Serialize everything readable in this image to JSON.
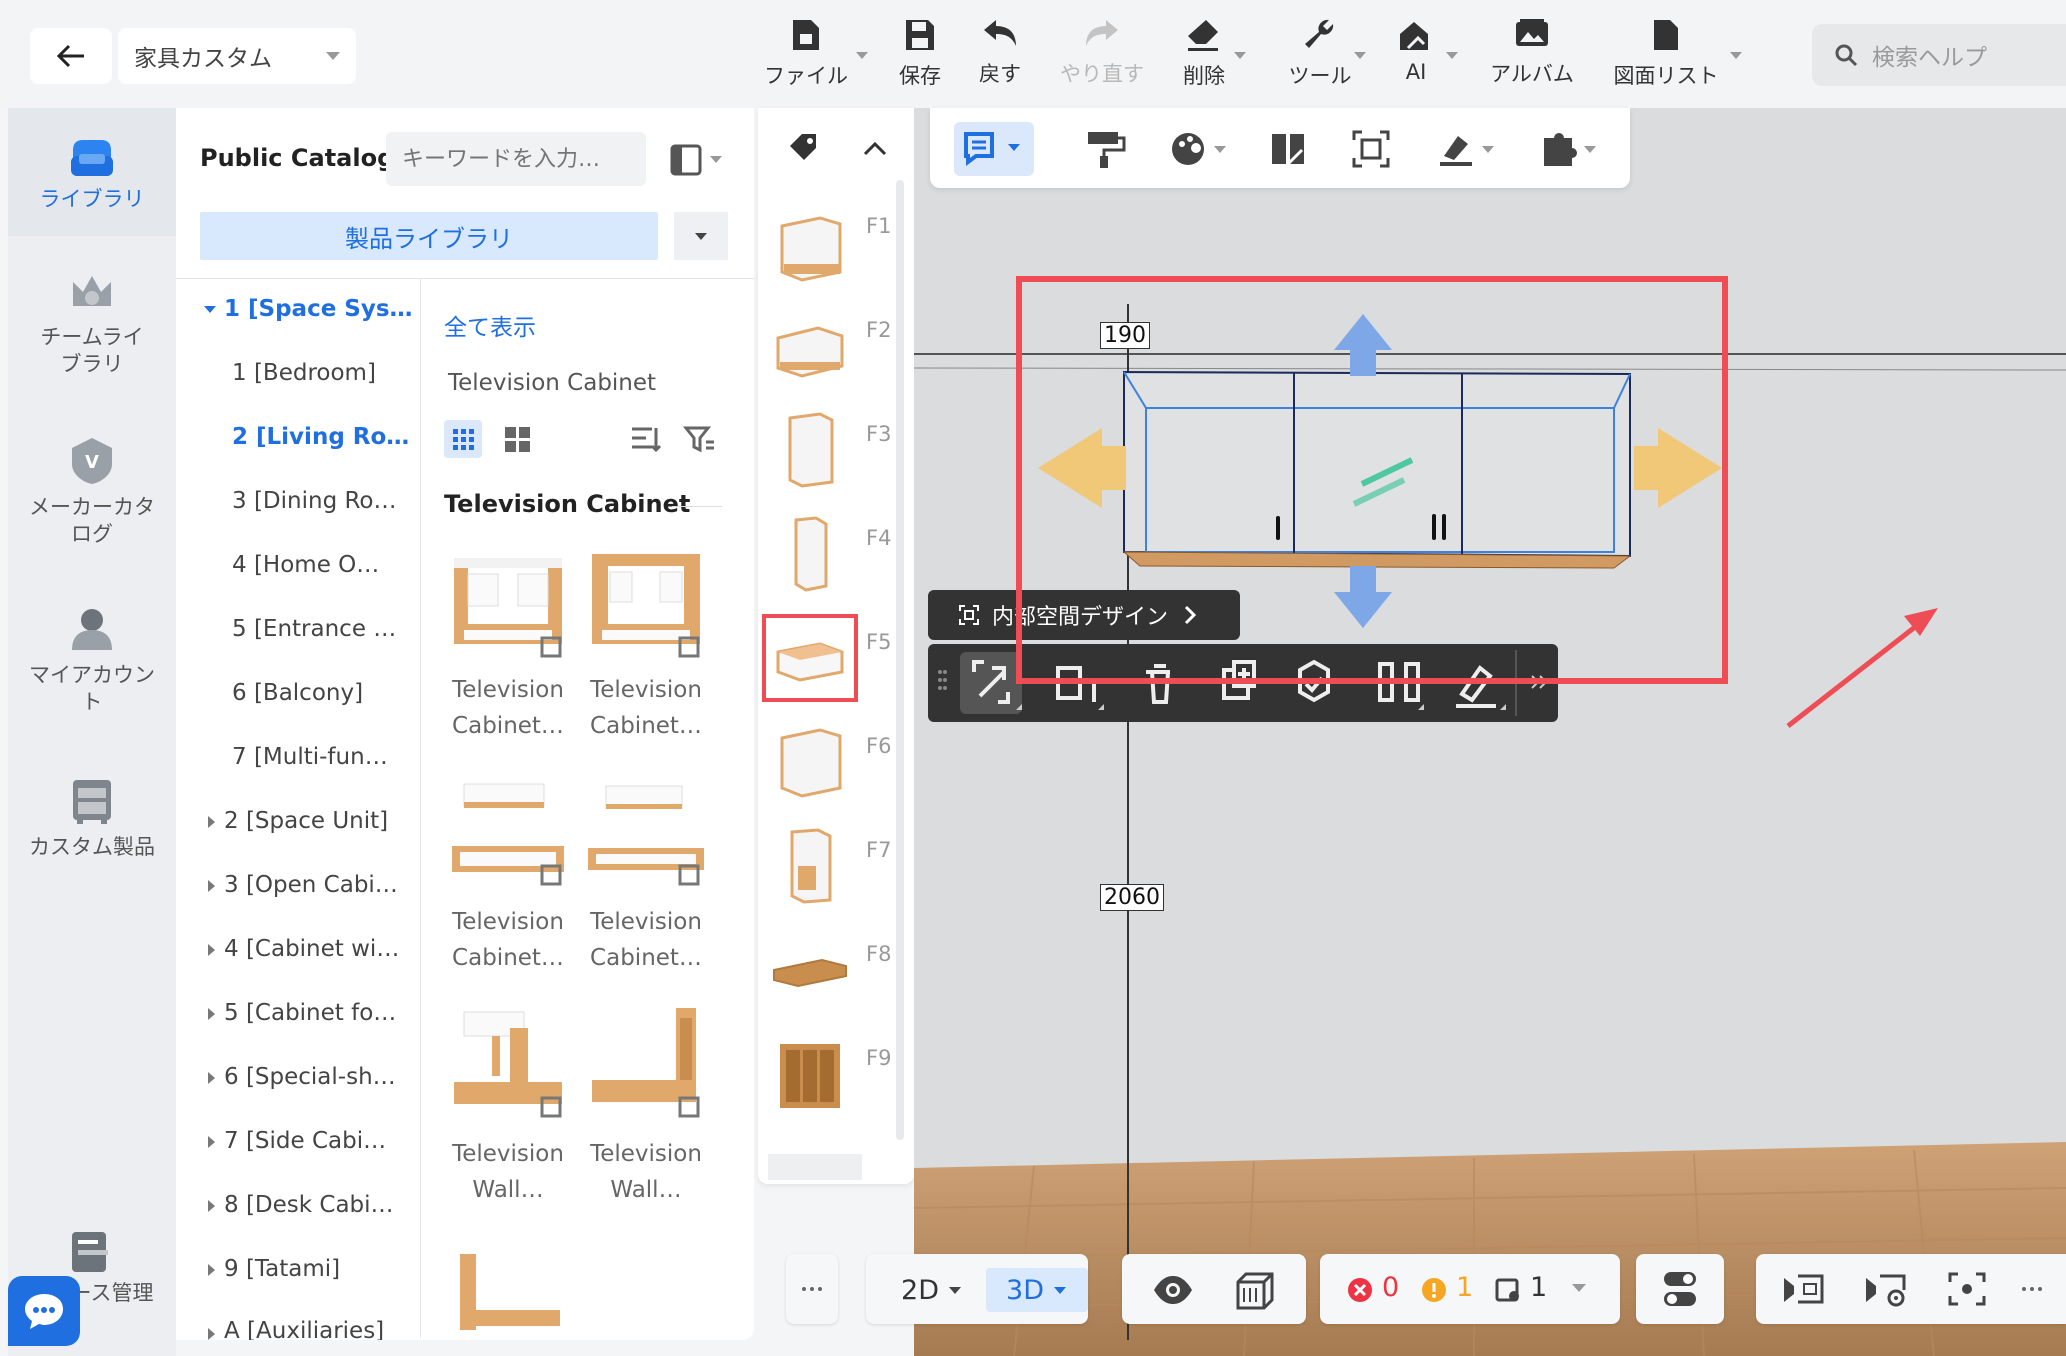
{
  "header": {
    "category_value": "家具カスタム",
    "toolbar": [
      {
        "id": "file",
        "label": "ファイル",
        "icon": "file-icon",
        "has_menu": true
      },
      {
        "id": "save",
        "label": "保存",
        "icon": "save-icon",
        "has_menu": false
      },
      {
        "id": "undo",
        "label": "戻す",
        "icon": "undo-icon",
        "has_menu": false
      },
      {
        "id": "redo",
        "label": "やり直す",
        "icon": "redo-icon",
        "has_menu": false,
        "disabled": true
      },
      {
        "id": "delete",
        "label": "削除",
        "icon": "eraser-icon",
        "has_menu": true
      },
      {
        "id": "tools",
        "label": "ツール",
        "icon": "wrench-icon",
        "has_menu": true
      },
      {
        "id": "ai",
        "label": "AI",
        "icon": "ai-house-icon",
        "has_menu": true
      },
      {
        "id": "album",
        "label": "アルバム",
        "icon": "album-icon",
        "has_menu": false
      },
      {
        "id": "drawings",
        "label": "図面リスト",
        "icon": "document-icon",
        "has_menu": true
      }
    ],
    "help_placeholder": "検索ヘルプ"
  },
  "sidebar": {
    "items": [
      {
        "label": "ライブラリ",
        "icon": "library-icon",
        "active": true
      },
      {
        "label": "チームライブラリ",
        "icon": "crown-icon",
        "active": false
      },
      {
        "label": "メーカーカタログ",
        "icon": "badge-icon",
        "active": false
      },
      {
        "label": "マイアカウント",
        "icon": "user-icon",
        "active": false
      },
      {
        "label": "カスタム製品",
        "icon": "cabinet-icon",
        "active": false
      },
      {
        "label": "ース管理",
        "icon": "manage-icon",
        "active": false
      }
    ]
  },
  "catalog": {
    "title": "Public Catalog",
    "search_placeholder": "キーワードを入力…",
    "library_button": "製品ライブラリ",
    "tree": [
      {
        "label": "1 [Space Sys…",
        "level": 0,
        "expanded": true,
        "selected": true
      },
      {
        "label": "1 [Bedroom]",
        "level": 1
      },
      {
        "label": "2 [Living Ro…",
        "level": 1,
        "selected": true
      },
      {
        "label": "3 [Dining Ro…",
        "level": 1
      },
      {
        "label": "4 [Home O…",
        "level": 1
      },
      {
        "label": "5 [Entrance …",
        "level": 1
      },
      {
        "label": "6 [Balcony]",
        "level": 1
      },
      {
        "label": "7 [Multi-fun…",
        "level": 1
      },
      {
        "label": "2 [Space Unit]",
        "level": 0
      },
      {
        "label": "3 [Open Cabi…",
        "level": 0
      },
      {
        "label": "4 [Cabinet wi…",
        "level": 0
      },
      {
        "label": "5 [Cabinet fo…",
        "level": 0
      },
      {
        "label": "6 [Special-sh…",
        "level": 0
      },
      {
        "label": "7 [Side Cabi…",
        "level": 0
      },
      {
        "label": "8 [Desk Cabi…",
        "level": 0
      },
      {
        "label": "9 [Tatami]",
        "level": 0
      },
      {
        "label": "A [Auxiliaries]",
        "level": 0
      }
    ],
    "show_all": "全て表示",
    "subcategory": "Television Cabinet",
    "section_title": "Television Cabinet",
    "products": [
      {
        "line1": "Television",
        "line2": "Cabinet…"
      },
      {
        "line1": "Television",
        "line2": "Cabinet…"
      },
      {
        "line1": "Television",
        "line2": "Cabinet…"
      },
      {
        "line1": "Television",
        "line2": "Cabinet…"
      },
      {
        "line1": "Television",
        "line2": "Wall…"
      },
      {
        "line1": "Television",
        "line2": "Wall…"
      }
    ]
  },
  "strip": {
    "labels": [
      "F1",
      "F2",
      "F3",
      "F4",
      "F5",
      "F6",
      "F7",
      "F8",
      "F9"
    ],
    "highlighted": "F5"
  },
  "viewport": {
    "dim_top": "190",
    "dim_side": "2060",
    "inner_space_label": "内部空間デザイン"
  },
  "bottom": {
    "view_2d": "2D",
    "view_3d": "3D",
    "error_count": "0",
    "warning_count": "1",
    "other_count": "1"
  },
  "colors": {
    "accent": "#1f6fe0",
    "highlight_red": "#ee4d55",
    "wood": "#e0a86a",
    "arrow_yellow": "#f0c878",
    "arrow_blue": "#7ea7e8"
  }
}
